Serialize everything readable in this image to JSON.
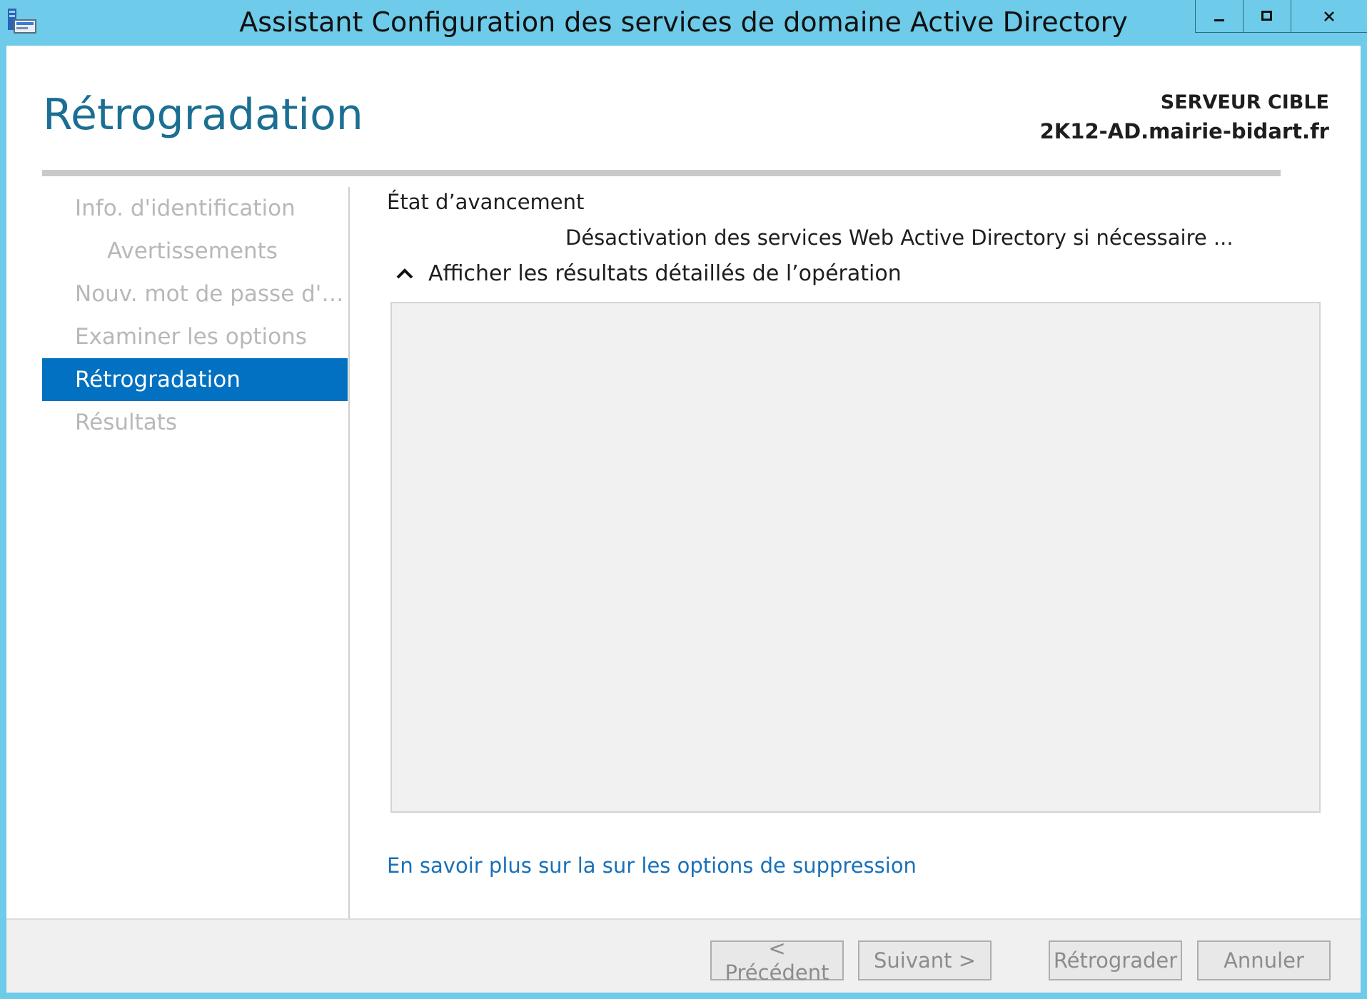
{
  "window": {
    "title": "Assistant Configuration des services de domaine Active Directory",
    "icon": "server-manager-icon",
    "controls": [
      "minimize-icon",
      "maximize-icon",
      "close-icon"
    ],
    "close_glyph": "✕"
  },
  "header": {
    "page_title": "Rétrogradation",
    "target_label": "SERVEUR CIBLE",
    "target_server": "2K12-AD.mairie-bidart.fr"
  },
  "nav": {
    "items": [
      {
        "label": "Info. d'identification",
        "state": "disabled"
      },
      {
        "label": "Avertissements",
        "state": "disabled"
      },
      {
        "label": "Nouv. mot de passe d'ad...",
        "state": "disabled"
      },
      {
        "label": "Examiner les options",
        "state": "disabled"
      },
      {
        "label": "Rétrogradation",
        "state": "active"
      },
      {
        "label": "Résultats",
        "state": "disabled"
      }
    ]
  },
  "content": {
    "progress_label": "État d’avancement",
    "status_text": "Désactivation des services Web Active Directory si nécessaire ...",
    "details_toggle_label": "Afficher les résultats détaillés de l’opération",
    "details_icon": "chevron-up-icon",
    "more_link": "En savoir plus sur la sur les options de suppression"
  },
  "footer": {
    "prev_label": "< Précédent",
    "next_label": "Suivant >",
    "demote_label": "Rétrograder",
    "cancel_label": "Annuler"
  },
  "colors": {
    "titlebar": "#6ecbea",
    "accent": "#0271c1",
    "title_text": "#1b6f92",
    "link": "#1a70b8",
    "disabled_text": "#b8b8b8"
  }
}
